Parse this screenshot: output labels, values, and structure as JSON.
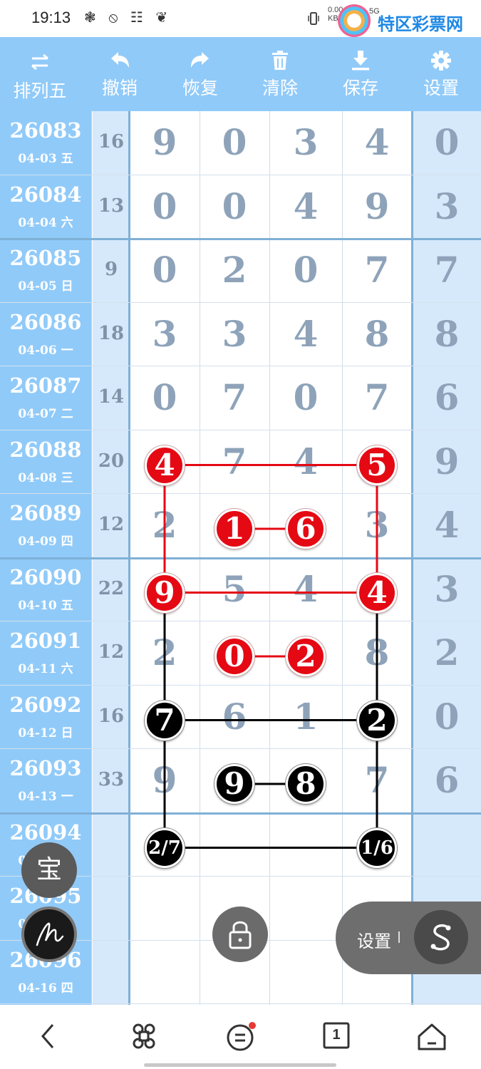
{
  "status_bar": {
    "time": "19:13",
    "left_icons": "❃ ⦸ ☷ ❦",
    "net_speed": "0.00",
    "net_unit": "KB/s",
    "signal": "5G",
    "brand": "特区彩票网"
  },
  "toolbar": {
    "items": [
      {
        "label": "排列五",
        "icon": "swap-icon"
      },
      {
        "label": "撤销",
        "icon": "undo-icon"
      },
      {
        "label": "恢复",
        "icon": "redo-icon"
      },
      {
        "label": "清除",
        "icon": "trash-icon"
      },
      {
        "label": "保存",
        "icon": "download-icon"
      },
      {
        "label": "设置",
        "icon": "gear-icon"
      }
    ]
  },
  "rows": [
    {
      "issue": "26083",
      "date": "04-03 五",
      "sum": "16",
      "digits": [
        "9",
        "0",
        "3",
        "4"
      ],
      "extra": "0"
    },
    {
      "issue": "26084",
      "date": "04-04 六",
      "sum": "13",
      "digits": [
        "0",
        "0",
        "4",
        "9"
      ],
      "extra": "3"
    },
    {
      "issue": "26085",
      "date": "04-05 日",
      "sum": "9",
      "digits": [
        "0",
        "2",
        "0",
        "7"
      ],
      "extra": "7"
    },
    {
      "issue": "26086",
      "date": "04-06 一",
      "sum": "18",
      "digits": [
        "3",
        "3",
        "4",
        "8"
      ],
      "extra": "8"
    },
    {
      "issue": "26087",
      "date": "04-07 二",
      "sum": "14",
      "digits": [
        "0",
        "7",
        "0",
        "7"
      ],
      "extra": "6"
    },
    {
      "issue": "26088",
      "date": "04-08 三",
      "sum": "20",
      "digits": [
        "4",
        "7",
        "4",
        "5"
      ],
      "extra": "9"
    },
    {
      "issue": "26089",
      "date": "04-09 四",
      "sum": "12",
      "digits": [
        "2",
        "1",
        "6",
        "3"
      ],
      "extra": "4"
    },
    {
      "issue": "26090",
      "date": "04-10 五",
      "sum": "22",
      "digits": [
        "9",
        "5",
        "4",
        "4"
      ],
      "extra": "3"
    },
    {
      "issue": "26091",
      "date": "04-11 六",
      "sum": "12",
      "digits": [
        "2",
        "0",
        "2",
        "8"
      ],
      "extra": "2"
    },
    {
      "issue": "26092",
      "date": "04-12 日",
      "sum": "16",
      "digits": [
        "7",
        "6",
        "1",
        "2"
      ],
      "extra": "0"
    },
    {
      "issue": "26093",
      "date": "04-13 一",
      "sum": "33",
      "digits": [
        "9",
        "9",
        "8",
        "7"
      ],
      "extra": "6"
    },
    {
      "issue": "26094",
      "date": "04-14 二",
      "sum": "",
      "digits": [
        "",
        "",
        "",
        ""
      ],
      "extra": ""
    },
    {
      "issue": "26095",
      "date": "04-15 三",
      "sum": "",
      "digits": [
        "",
        "",
        "",
        ""
      ],
      "extra": ""
    },
    {
      "issue": "26096",
      "date": "04-16 四",
      "sum": "",
      "digits": [
        "",
        "",
        "",
        ""
      ],
      "extra": ""
    }
  ],
  "markers": [
    {
      "row": 5,
      "col": 0,
      "text": "4",
      "color": "red"
    },
    {
      "row": 5,
      "col": 3,
      "text": "5",
      "color": "red"
    },
    {
      "row": 6,
      "col": 1,
      "text": "1",
      "color": "red"
    },
    {
      "row": 6,
      "col": 2,
      "text": "6",
      "color": "red"
    },
    {
      "row": 7,
      "col": 0,
      "text": "9",
      "color": "red"
    },
    {
      "row": 7,
      "col": 3,
      "text": "4",
      "color": "red"
    },
    {
      "row": 8,
      "col": 1,
      "text": "0",
      "color": "red"
    },
    {
      "row": 8,
      "col": 2,
      "text": "2",
      "color": "red"
    },
    {
      "row": 9,
      "col": 0,
      "text": "7",
      "color": "black"
    },
    {
      "row": 9,
      "col": 3,
      "text": "2",
      "color": "black"
    },
    {
      "row": 10,
      "col": 1,
      "text": "9",
      "color": "black"
    },
    {
      "row": 10,
      "col": 2,
      "text": "8",
      "color": "black"
    },
    {
      "row": 11,
      "col": 0,
      "text": "2/7",
      "color": "black"
    },
    {
      "row": 11,
      "col": 3,
      "text": "1/6",
      "color": "black"
    }
  ],
  "colors": {
    "red": "#e50914",
    "black": "#000000",
    "accent": "#90caf9",
    "digit": "#8ea3b9"
  },
  "floating": {
    "bao_label": "宝",
    "pen_icon": "signature-icon",
    "lock_icon": "lock-icon",
    "pill_label": "设置",
    "pill_icon": "s-icon"
  },
  "navbar": {
    "items": [
      "back-icon",
      "command-icon",
      "menu-icon",
      "tab-count-icon",
      "home-icon"
    ],
    "tab_count": "1"
  }
}
